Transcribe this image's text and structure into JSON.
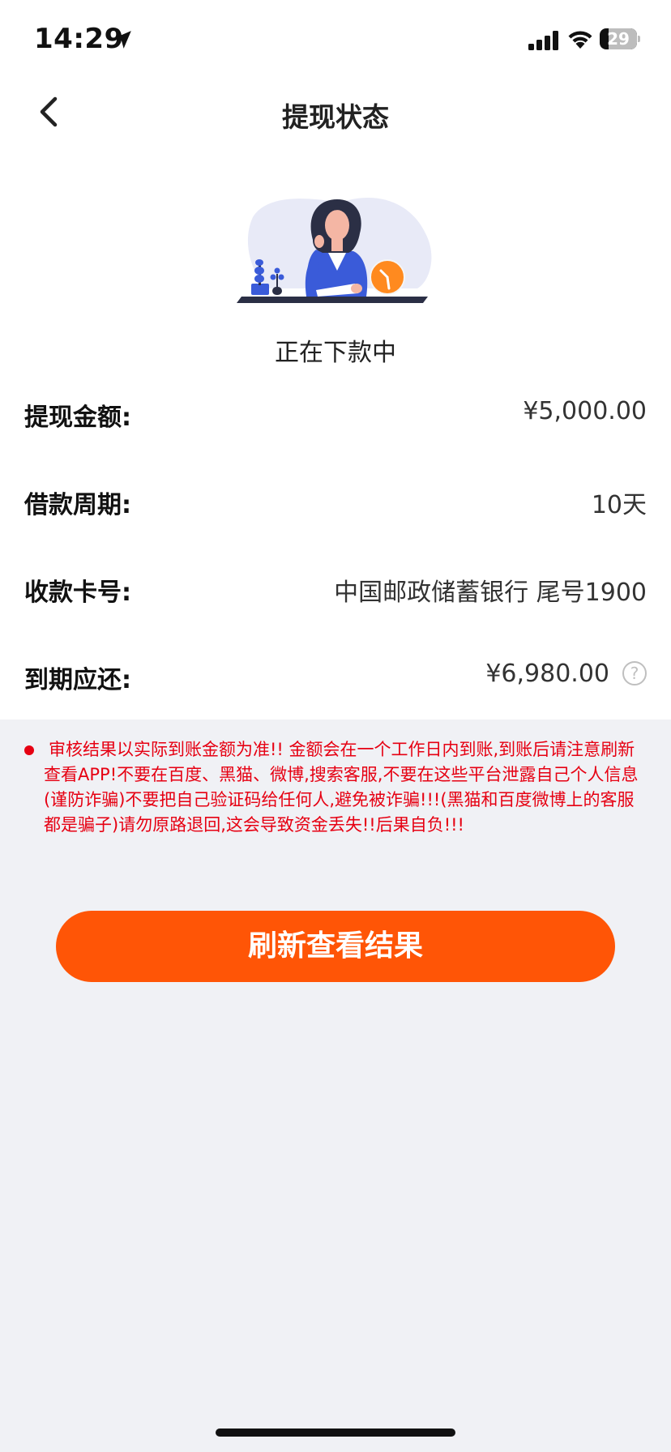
{
  "status_bar": {
    "time": "14:29",
    "battery_level": "29",
    "icons": [
      "location-arrow-icon",
      "cellular-signal-icon",
      "wifi-icon",
      "battery-icon"
    ]
  },
  "nav": {
    "back_icon": "chevron-left-icon",
    "title": "提现状态"
  },
  "status": {
    "illustration": "woman-waiting-with-clock-illustration",
    "label": "正在下款中"
  },
  "details": [
    {
      "label": "提现金额:",
      "value": "¥5,000.00"
    },
    {
      "label": "借款周期:",
      "value": "10天"
    },
    {
      "label": "收款卡号:",
      "value": "中国邮政储蓄银行 尾号1900"
    },
    {
      "label": "到期应还:",
      "value": "¥6,980.00",
      "help_icon": "question-circle-icon"
    }
  ],
  "notice": {
    "text": "审核结果以实际到账金额为准!! 金额会在一个工作日内到账,到账后请注意刷新查看APP!不要在百度、黑猫、微博,搜索客服,不要在这些平台泄露自己个人信息(谨防诈骗)不要把自己验证码给任何人,避免被诈骗!!!(黑猫和百度微博上的客服都是骗子)请勿原路退回,这会导致资金丢失!!后果自负!!!",
    "color": "#E60012"
  },
  "refresh_button": {
    "label": "刷新查看结果",
    "color": "#FF5506"
  },
  "colors": {
    "background": "#F0F1F5",
    "card": "#FFFFFF",
    "accent": "#FF5506"
  }
}
